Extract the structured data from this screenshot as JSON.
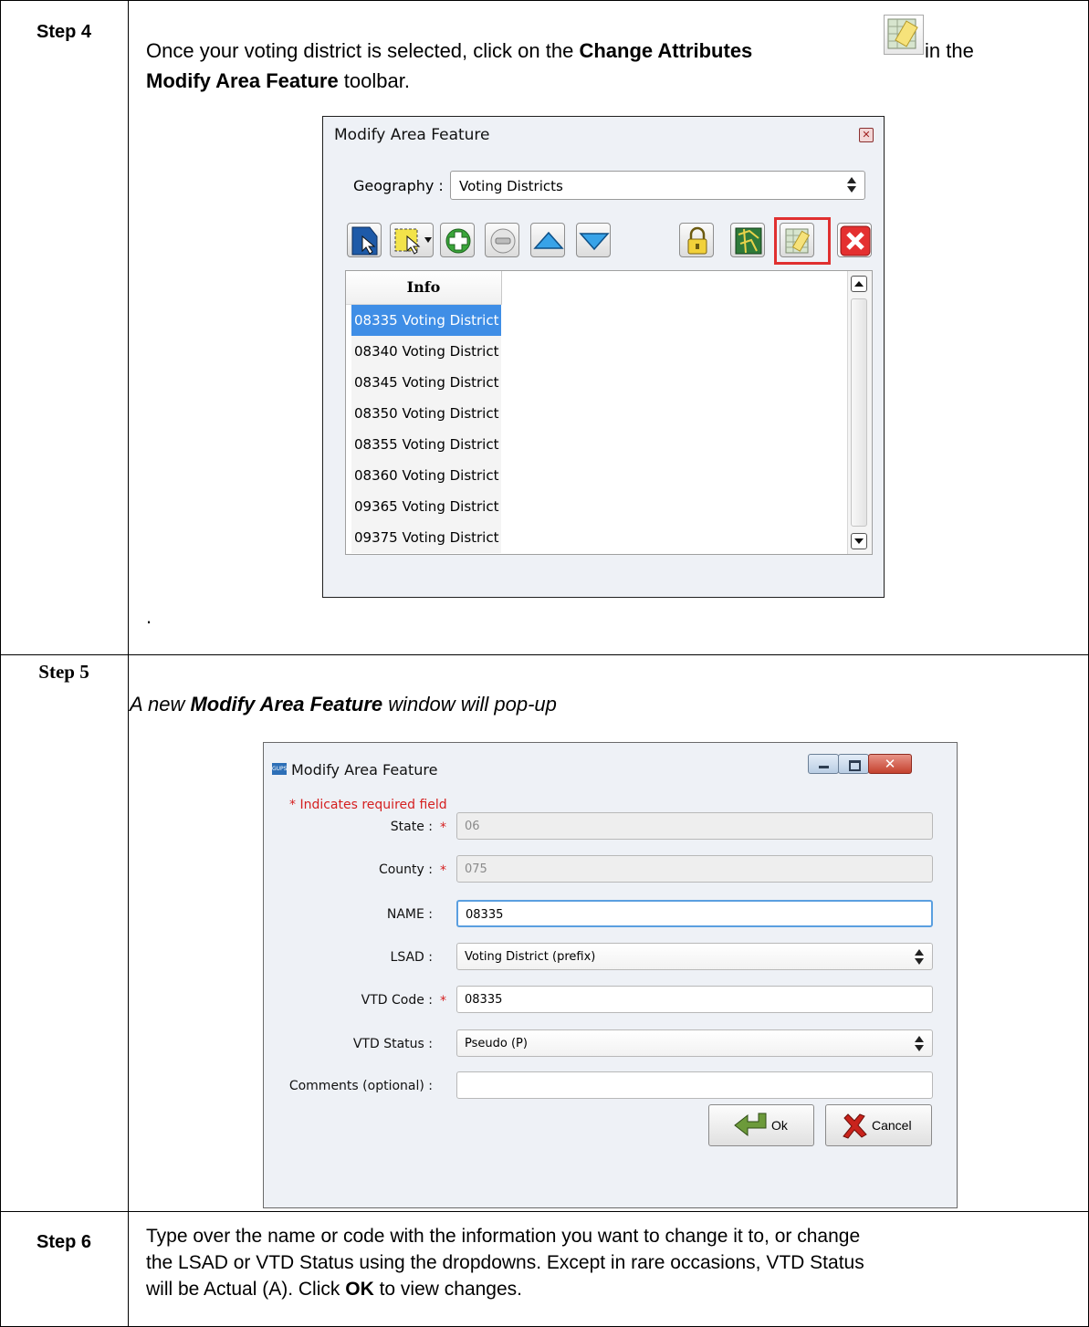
{
  "steps": [
    {
      "label": "Step 4",
      "text_before": "Once your voting district is selected, click on the ",
      "text_bold1": "Change Attributes",
      "text_mid": " in the",
      "text_bold2": "Modify Area Feature",
      "text_after": " toolbar.",
      "trailing": "."
    },
    {
      "label": "Step 5",
      "text_italic_before": "A new ",
      "text_italic_bold": "Modify Area Feature",
      "text_italic_after": " window will pop-up"
    },
    {
      "label": "Step 6",
      "line1": "Type over the name or code with the information you want to change it to, or change",
      "line2": "the LSAD or VTD Status using the dropdowns. Except in rare occasions, VTD Status",
      "line3_before": "will be Actual (A). Click ",
      "line3_bold": "OK",
      "line3_after": " to view changes."
    }
  ],
  "dialog1": {
    "title": "Modify Area Feature",
    "geography_label": "Geography :",
    "geography_value": "Voting Districts",
    "toolbar_icons": [
      "select-feature-icon",
      "area-select-icon",
      "add-icon",
      "remove-icon",
      "move-up-icon",
      "move-down-icon",
      "lock-icon",
      "map-icon",
      "change-attributes-icon",
      "delete-icon"
    ],
    "list_header": "Info",
    "list_items": [
      "08335 Voting District",
      "08340 Voting District",
      "08345 Voting District",
      "08350 Voting District",
      "08355 Voting District",
      "08360 Voting District",
      "09365 Voting District",
      "09375 Voting District"
    ],
    "selected_index": 0
  },
  "dialog2": {
    "title": "Modify Area Feature",
    "required_note": "* Indicates required field",
    "fields": [
      {
        "label": "State :",
        "required": true,
        "value": "06",
        "kind": "readonly"
      },
      {
        "label": "County :",
        "required": true,
        "value": "075",
        "kind": "readonly"
      },
      {
        "label": "NAME :",
        "required": false,
        "value": "08335",
        "kind": "focused"
      },
      {
        "label": "LSAD :",
        "required": false,
        "value": "Voting District (prefix)",
        "kind": "dropdown"
      },
      {
        "label": "VTD Code :",
        "required": true,
        "value": "08335",
        "kind": "text"
      },
      {
        "label": "VTD Status :",
        "required": false,
        "value": "Pseudo (P)",
        "kind": "dropdown"
      },
      {
        "label": "Comments (optional) :",
        "required": false,
        "value": "",
        "kind": "text"
      }
    ],
    "ok_label": "Ok",
    "cancel_label": "Cancel",
    "close_glyph": "✕"
  },
  "colors": {
    "selection": "#3f8ee6",
    "highlight": "#e03030",
    "required": "#d52020"
  }
}
